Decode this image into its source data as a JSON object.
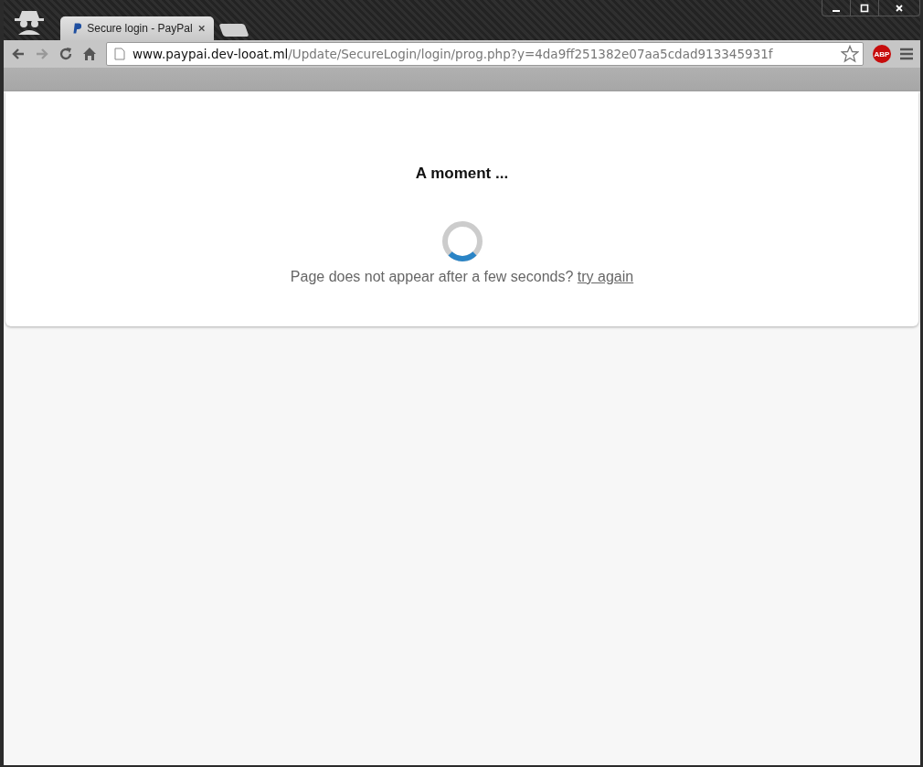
{
  "tabs": [
    {
      "title": "Secure login - PayPal",
      "selected": true
    }
  ],
  "address_bar": {
    "host": "www.paypai.dev-looat.ml",
    "path": "/Update/SecureLogin/login/prog.php?y=4da9ff251382e07aa5cdad913345931f"
  },
  "extension_badge": "ABP",
  "page": {
    "heading": "A moment ...",
    "message": "Page does not appear after a few seconds?",
    "link": "try again"
  }
}
